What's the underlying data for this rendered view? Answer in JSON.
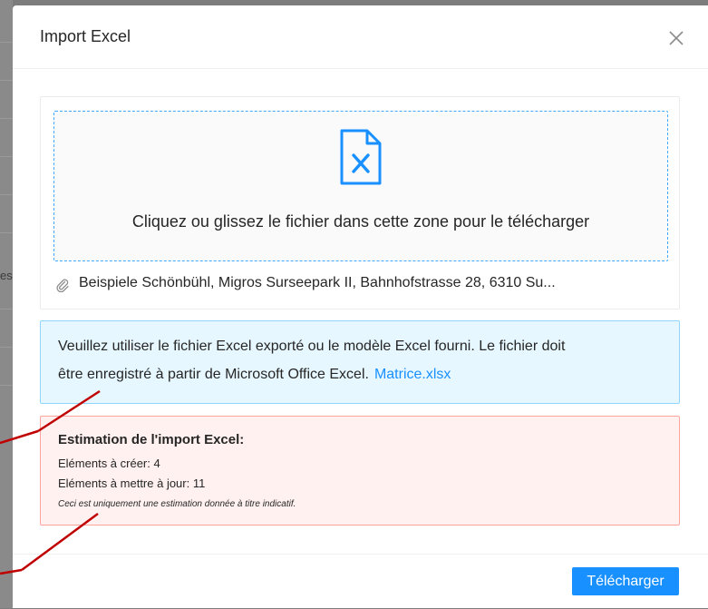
{
  "background": {
    "partial_text": "es"
  },
  "modal": {
    "title": "Import Excel",
    "close_icon": "close-icon"
  },
  "upload": {
    "dragger_text": "Cliquez ou glissez le fichier dans cette zone pour le télécharger",
    "file_icon": "excel-file-icon",
    "file_name": "Beispiele Schönbühl, Migros Surseepark II, Bahnhofstrasse 28, 6310 Su...",
    "attachment_icon": "paperclip-icon"
  },
  "info": {
    "line1": "Veuillez utiliser le fichier Excel exporté ou le modèle Excel fourni. Le fichier doit",
    "line2": "être enregistré à partir de Microsoft Office Excel.",
    "link": "Matrice.xlsx"
  },
  "estimate": {
    "title": "Estimation de l'import Excel:",
    "create_label": "Eléments à créer: 4",
    "update_label": "Eléments à mettre à jour: 11",
    "note": "Ceci est uniquement une estimation donnée à titre indicatif."
  },
  "footer": {
    "upload_button": "Télécharger"
  },
  "colors": {
    "accent": "#1890ff",
    "info_bg": "#e6f7ff",
    "warning_bg": "#fff1f0",
    "annotation": "#c00000"
  }
}
